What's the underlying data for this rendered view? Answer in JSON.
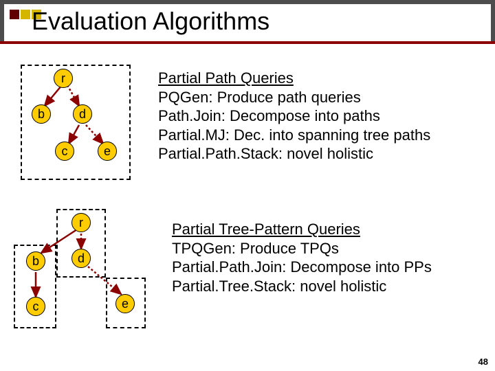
{
  "title": "Evaluation Algorithms",
  "accent_colors": {
    "dark_red": "#600000",
    "mustard": "#d4b500",
    "node_fill": "#ffcc00"
  },
  "nodes": {
    "r": "r",
    "b": "b",
    "d": "d",
    "c": "c",
    "e": "e"
  },
  "section1": {
    "heading": "Partial Path Queries",
    "lines": [
      "PQGen: Produce path queries",
      "Path.Join: Decompose into paths",
      "Partial.MJ: Dec. into spanning tree paths",
      "Partial.Path.Stack: novel holistic"
    ]
  },
  "section2": {
    "heading": "Partial Tree-Pattern Queries",
    "lines": [
      "TPQGen: Produce TPQs",
      "Partial.Path.Join: Decompose into PPs",
      "Partial.Tree.Stack: novel holistic"
    ]
  },
  "page_number": "48"
}
